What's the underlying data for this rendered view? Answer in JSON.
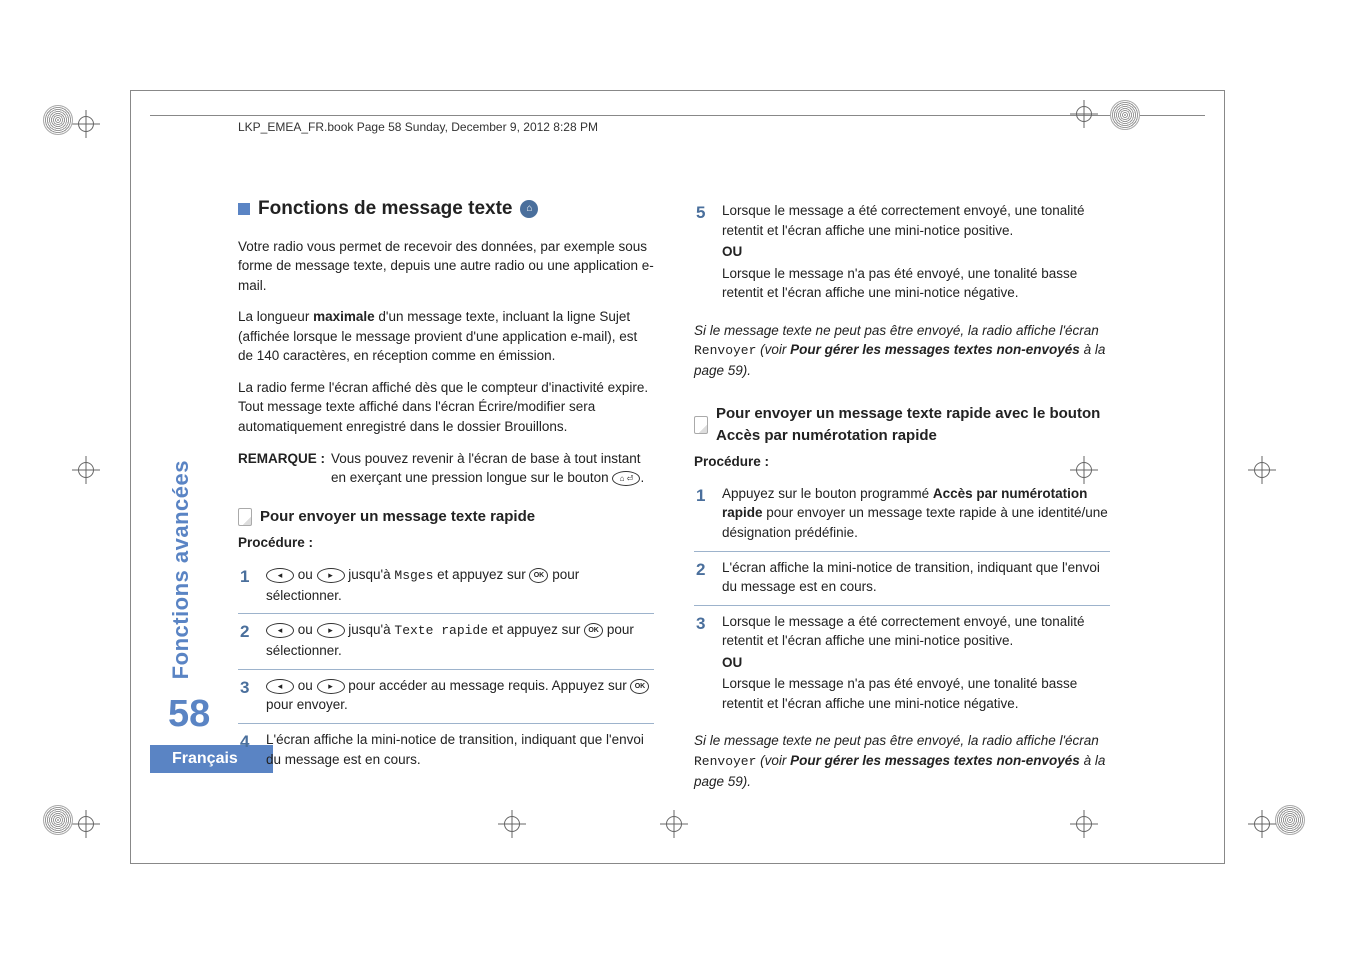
{
  "header": "LKP_EMEA_FR.book  Page 58  Sunday, December 9, 2012  8:28 PM",
  "sidebar_title": "Fonctions avancées",
  "page_number": "58",
  "language": "Français",
  "left": {
    "title": "Fonctions de message texte",
    "p1": "Votre radio vous permet de recevoir des données, par exemple sous forme de message texte, depuis une autre radio ou une application e-mail.",
    "p2_a": "La longueur ",
    "p2_b": "maximale",
    "p2_c": " d'un message texte, incluant la ligne Sujet (affichée lorsque le message provient d'une application e-mail), est de 140 caractères, en réception comme en émission.",
    "p3": "La radio ferme l'écran affiché dès que le compteur d'inactivité expire. Tout message texte affiché dans l'écran Écrire/modifier sera automatiquement enregistré dans le dossier Brouillons.",
    "remark_label": "REMARQUE :",
    "remark_text": "Vous pouvez revenir à l'écran de base à tout instant en exerçant une pression longue sur le bouton ",
    "sub1": "Pour envoyer un message texte rapide",
    "proc_label": "Procédure :",
    "step1_a": " ou ",
    "step1_b": " jusqu'à ",
    "step1_m": "Msges",
    "step1_c": " et appuyez sur ",
    "step1_d": " pour sélectionner.",
    "step2_a": " ou ",
    "step2_b": " jusqu'à ",
    "step2_m": "Texte rapide",
    "step2_c": " et appuyez sur ",
    "step2_d": " pour sélectionner.",
    "step3_a": " ou ",
    "step3_b": " pour accéder au message requis. Appuyez sur ",
    "step3_c": " pour envoyer.",
    "step4": "L'écran affiche la mini-notice de transition, indiquant que l'envoi du message est en cours."
  },
  "right": {
    "step5_a": "Lorsque le message a été correctement envoyé, une tonalité retentit et l'écran affiche une mini-notice positive.",
    "step5_ou": "OU",
    "step5_b": "Lorsque le message n'a pas été envoyé, une tonalité basse retentit et l'écran affiche une mini-notice négative.",
    "note1_a": "Si le message texte ne peut pas être envoyé, la radio affiche l'écran ",
    "note1_m": "Renvoyer",
    "note1_b": " (voir ",
    "note1_ref": "Pour gérer les messages textes non-envoyés",
    "note1_c": " à la page 59).",
    "sub2": "Pour envoyer un message texte rapide avec le bouton Accès par numérotation rapide",
    "proc_label": "Procédure :",
    "r1_a": "Appuyez sur le bouton programmé ",
    "r1_b": "Accès par numérotation rapide",
    "r1_c": " pour envoyer un message texte rapide à une identité/une désignation prédéfinie.",
    "r2": "L'écran affiche la mini-notice de transition, indiquant que l'envoi du message est en cours.",
    "r3_a": "Lorsque le message a été correctement envoyé, une tonalité retentit et l'écran affiche une mini-notice positive.",
    "r3_ou": "OU",
    "r3_b": "Lorsque le message n'a pas été envoyé, une tonalité basse retentit et l'écran affiche une mini-notice négative.",
    "note2_a": "Si le message texte ne peut pas être envoyé, la radio affiche l'écran ",
    "note2_m": "Renvoyer",
    "note2_b": " (voir ",
    "note2_ref": "Pour gérer les messages textes non-envoyés",
    "note2_c": " à la page 59)."
  }
}
